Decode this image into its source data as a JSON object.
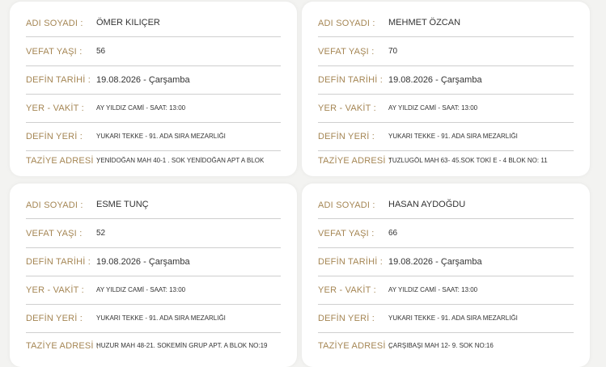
{
  "cards": [
    {
      "rows": [
        {
          "label": "ADI SOYADI :",
          "value": "ÖMER KILIÇER"
        },
        {
          "label": "VEFAT YAŞI :",
          "value": "56"
        },
        {
          "label": "DEFİN TARİHİ :",
          "value": "19.08.2026 - Çarşamba"
        },
        {
          "label": "YER - VAKİT :",
          "value": "AY YILDIZ CAMİ - SAAT: 13:00"
        },
        {
          "label": "DEFİN YERİ :",
          "value": "YUKARI TEKKE - 91. ADA SIRA MEZARLIĞI"
        },
        {
          "label": "TAZİYE ADRESİ :",
          "value": "YENİDOĞAN MAH 40-1 . SOK YENİDOĞAN APT A BLOK"
        }
      ]
    },
    {
      "rows": [
        {
          "label": "ADI SOYADI :",
          "value": "MEHMET ÖZCAN"
        },
        {
          "label": "VEFAT YAŞI :",
          "value": "70"
        },
        {
          "label": "DEFİN TARİHİ :",
          "value": "19.08.2026 - Çarşamba"
        },
        {
          "label": "YER - VAKİT :",
          "value": "AY YILDIZ CAMİ - SAAT: 13:00"
        },
        {
          "label": "DEFİN YERİ :",
          "value": "YUKARI TEKKE - 91. ADA SIRA MEZARLIĞI"
        },
        {
          "label": "TAZİYE ADRESİ :",
          "value": "TUZLUGÖL MAH 63- 45.SOK TOKİ E - 4 BLOK NO: 11"
        }
      ]
    },
    {
      "rows": [
        {
          "label": "ADI SOYADI :",
          "value": "ESME TUNÇ"
        },
        {
          "label": "VEFAT YAŞI :",
          "value": "52"
        },
        {
          "label": "DEFİN TARİHİ :",
          "value": "19.08.2026 - Çarşamba"
        },
        {
          "label": "YER - VAKİT :",
          "value": "AY YILDIZ CAMİ - SAAT: 13:00"
        },
        {
          "label": "DEFİN YERİ :",
          "value": "YUKARI TEKKE - 91. ADA SIRA MEZARLIĞI"
        },
        {
          "label": "TAZİYE ADRESİ :",
          "value": "HUZUR MAH 48-21. SOKEMİN GRUP APT. A BLOK NO:19"
        }
      ]
    },
    {
      "rows": [
        {
          "label": "ADI SOYADI :",
          "value": "HASAN AYDOĞDU"
        },
        {
          "label": "VEFAT YAŞI :",
          "value": "66"
        },
        {
          "label": "DEFİN TARİHİ :",
          "value": "19.08.2026 - Çarşamba"
        },
        {
          "label": "YER - VAKİT :",
          "value": "AY YILDIZ CAMİ - SAAT: 13:00"
        },
        {
          "label": "DEFİN YERİ :",
          "value": "YUKARI TEKKE - 91. ADA SIRA MEZARLIĞI"
        },
        {
          "label": "TAZİYE ADRESİ :",
          "value": "ÇARŞIBAŞI MAH 12- 9. SOK NO:16"
        }
      ]
    }
  ],
  "colors": {
    "label": "#a58654",
    "value": "#333333",
    "divider": "#cfcfcf",
    "card": "#ffffff",
    "background": "#f3f3f1"
  }
}
